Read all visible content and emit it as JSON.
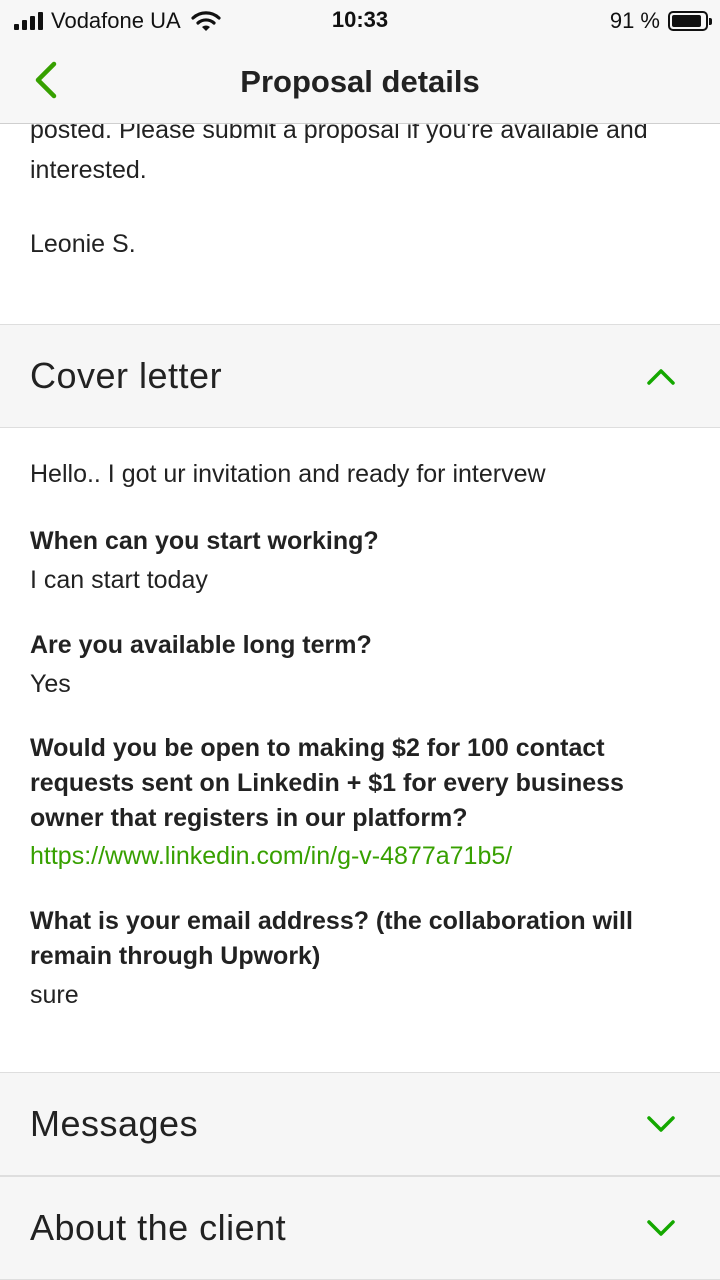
{
  "status_bar": {
    "carrier": "Vodafone UA",
    "time": "10:33",
    "battery_percent": "91 %",
    "battery_level": 0.91,
    "icons": [
      "signal-icon",
      "wifi-icon",
      "battery-icon"
    ]
  },
  "nav": {
    "title": "Proposal details",
    "back_icon": "chevron-left-icon"
  },
  "job_description": {
    "partial_text": "posted. Please submit a proposal if you're available and interested.",
    "signature": "Leonie S."
  },
  "cover_letter": {
    "title": "Cover letter",
    "expanded": true,
    "intro": "Hello.. I got ur invitation and ready for intervew",
    "qa": [
      {
        "question": "When can you start working?",
        "answer": "I can start today"
      },
      {
        "question": "Are you available long term?",
        "answer": "Yes"
      },
      {
        "question": "Would you be open to making $2 for 100 contact requests sent on Linkedin + $1 for every business owner that registers in our platform?",
        "answer": "https://www.linkedin.com/in/g-v-4877a71b5/"
      },
      {
        "question": "What is your email address? (the collaboration will remain through Upwork)",
        "answer": "sure"
      }
    ]
  },
  "sections": {
    "messages": {
      "title": "Messages",
      "expanded": false
    },
    "about_client": {
      "title": "About the client",
      "expanded": false
    }
  },
  "colors": {
    "accent_green": "#37a000",
    "chevron_green": "#14a800",
    "text": "#222222",
    "header_bg": "#f6f6f6"
  }
}
